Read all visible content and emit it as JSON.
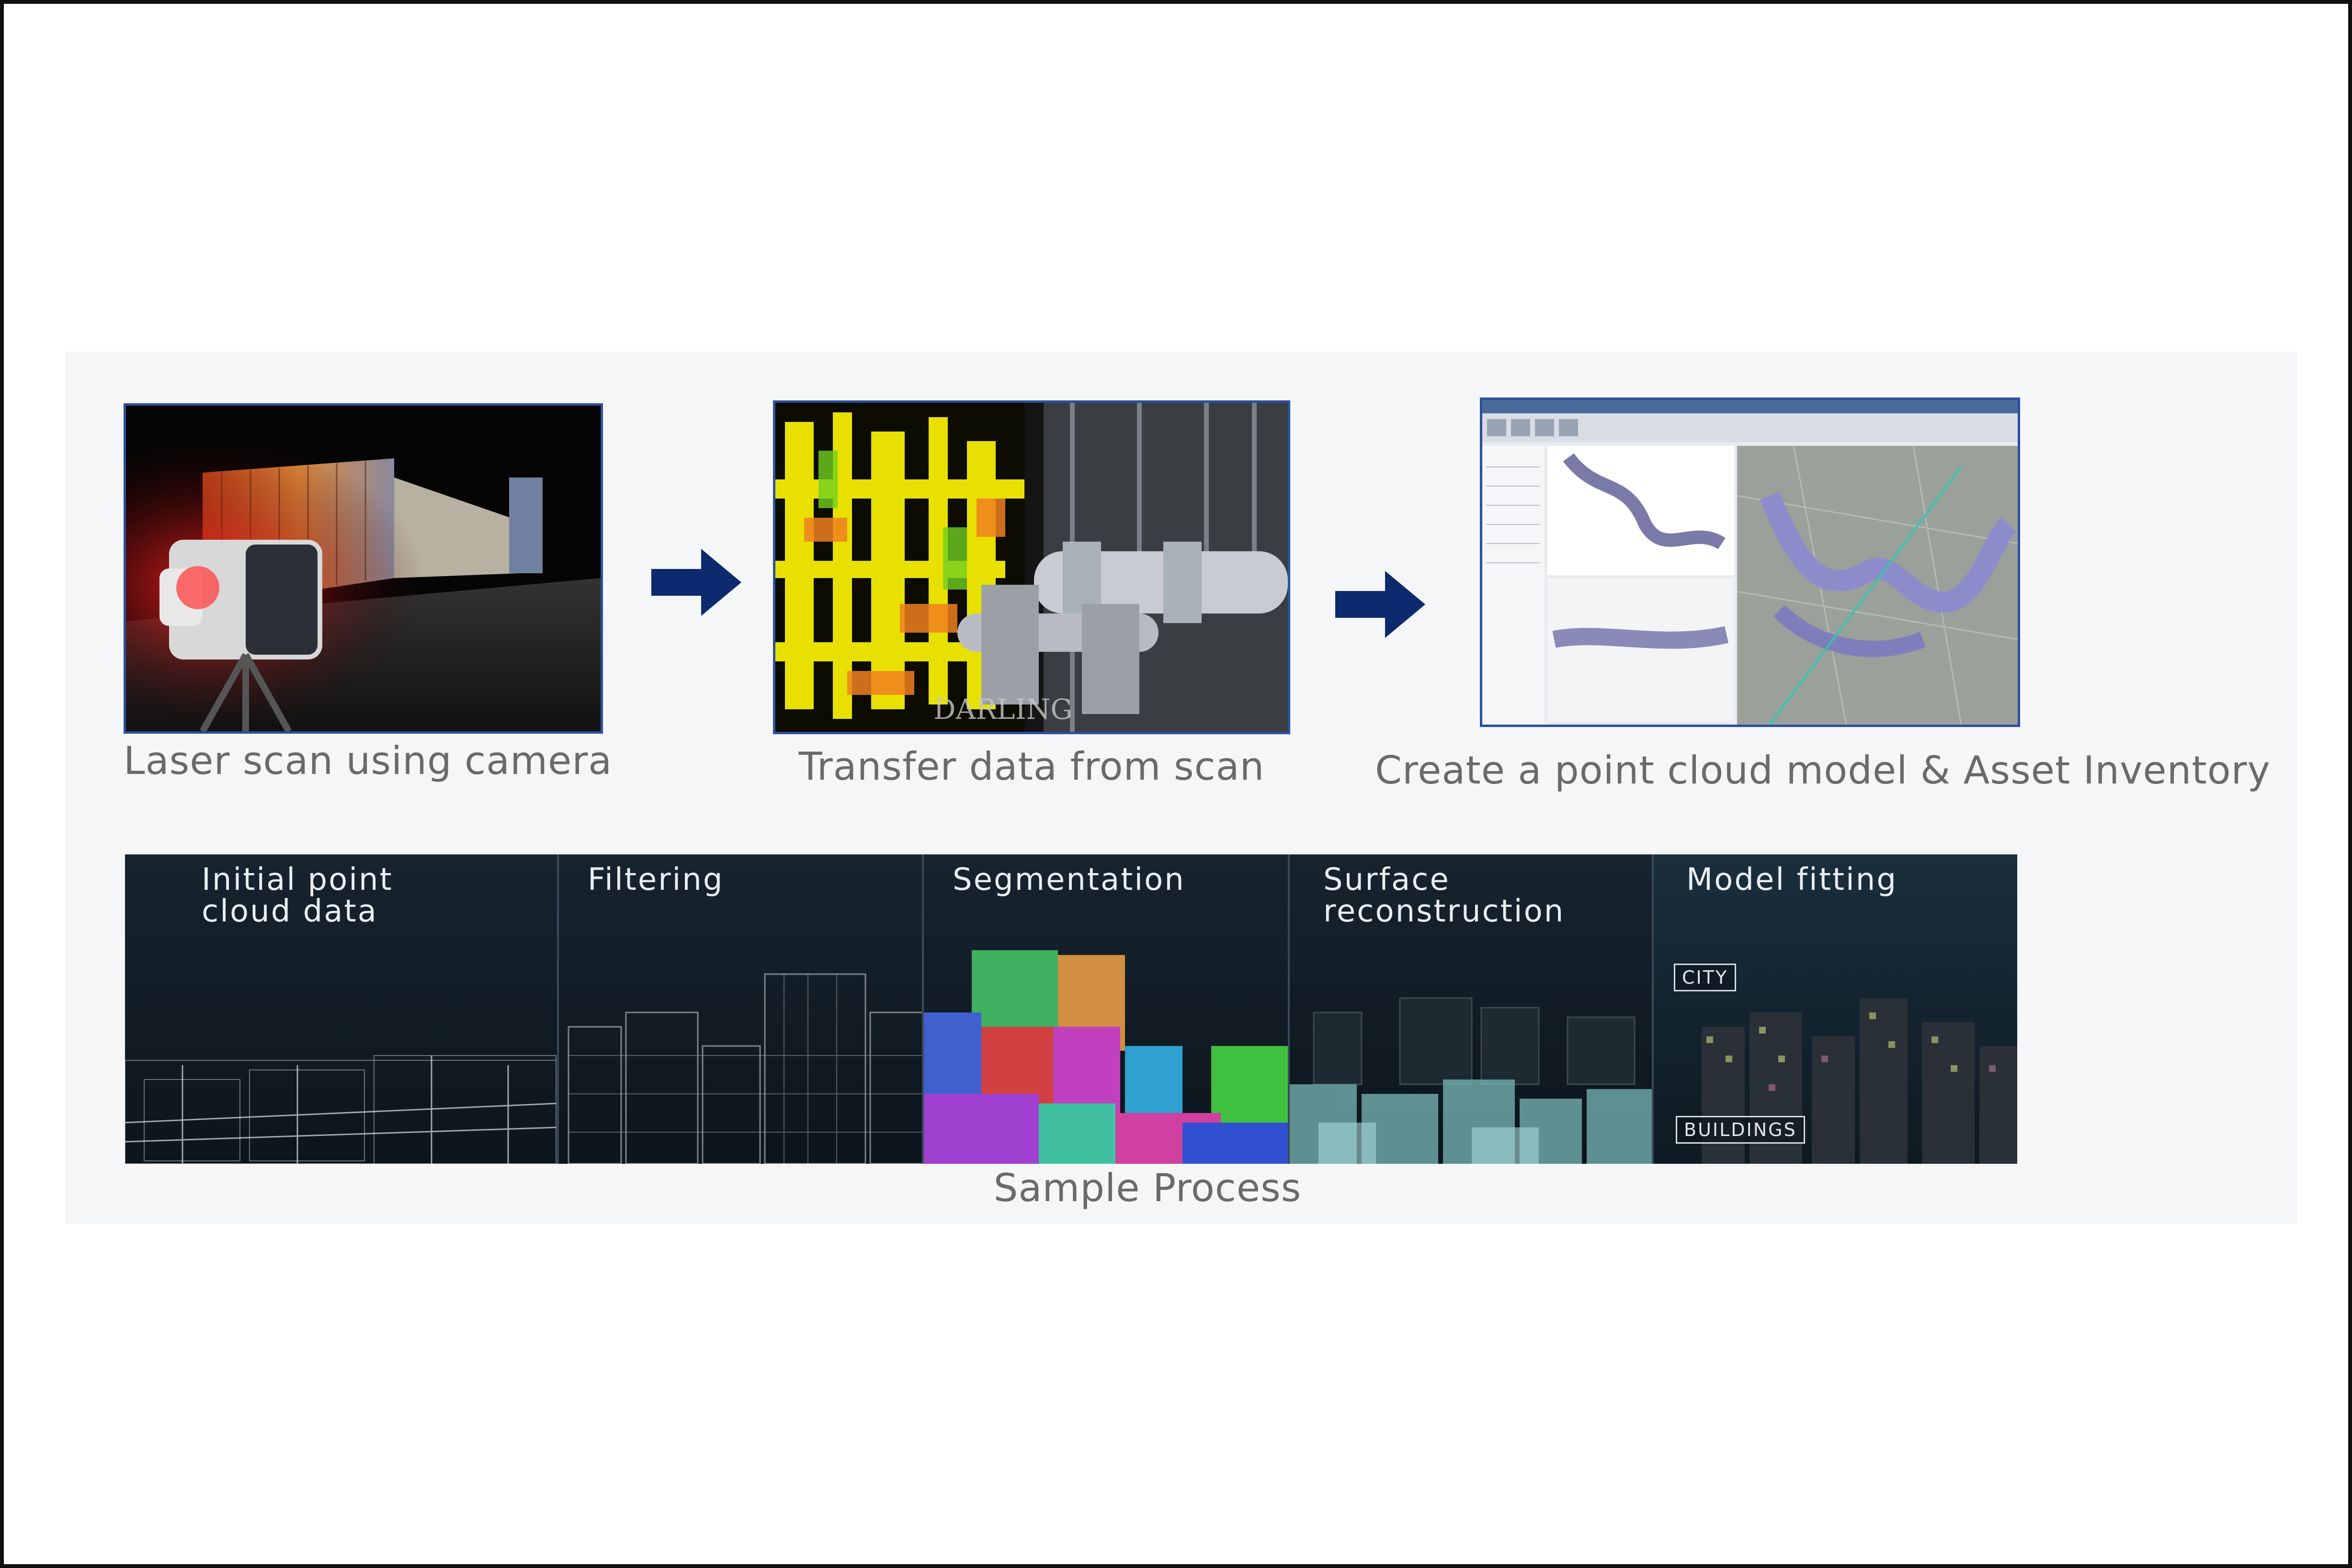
{
  "steps": [
    {
      "caption": "Laser scan using camera",
      "image": "laser-scanner-building"
    },
    {
      "caption": "Transfer data from scan",
      "image": "industrial-plant-point-cloud",
      "watermark": "DARLING"
    },
    {
      "caption": "Create a point cloud model & Asset Inventory",
      "image": "cad-software-pipe-model"
    }
  ],
  "arrow_color": "#0d2a6e",
  "process": {
    "caption": "Sample Process",
    "stages": [
      {
        "label": "Initial point\ncloud data"
      },
      {
        "label": "Filtering"
      },
      {
        "label": "Segmentation"
      },
      {
        "label": "Surface\nreconstruction"
      },
      {
        "label": "Model fitting",
        "tags": [
          "CITY",
          "BUILDINGS"
        ]
      }
    ]
  }
}
